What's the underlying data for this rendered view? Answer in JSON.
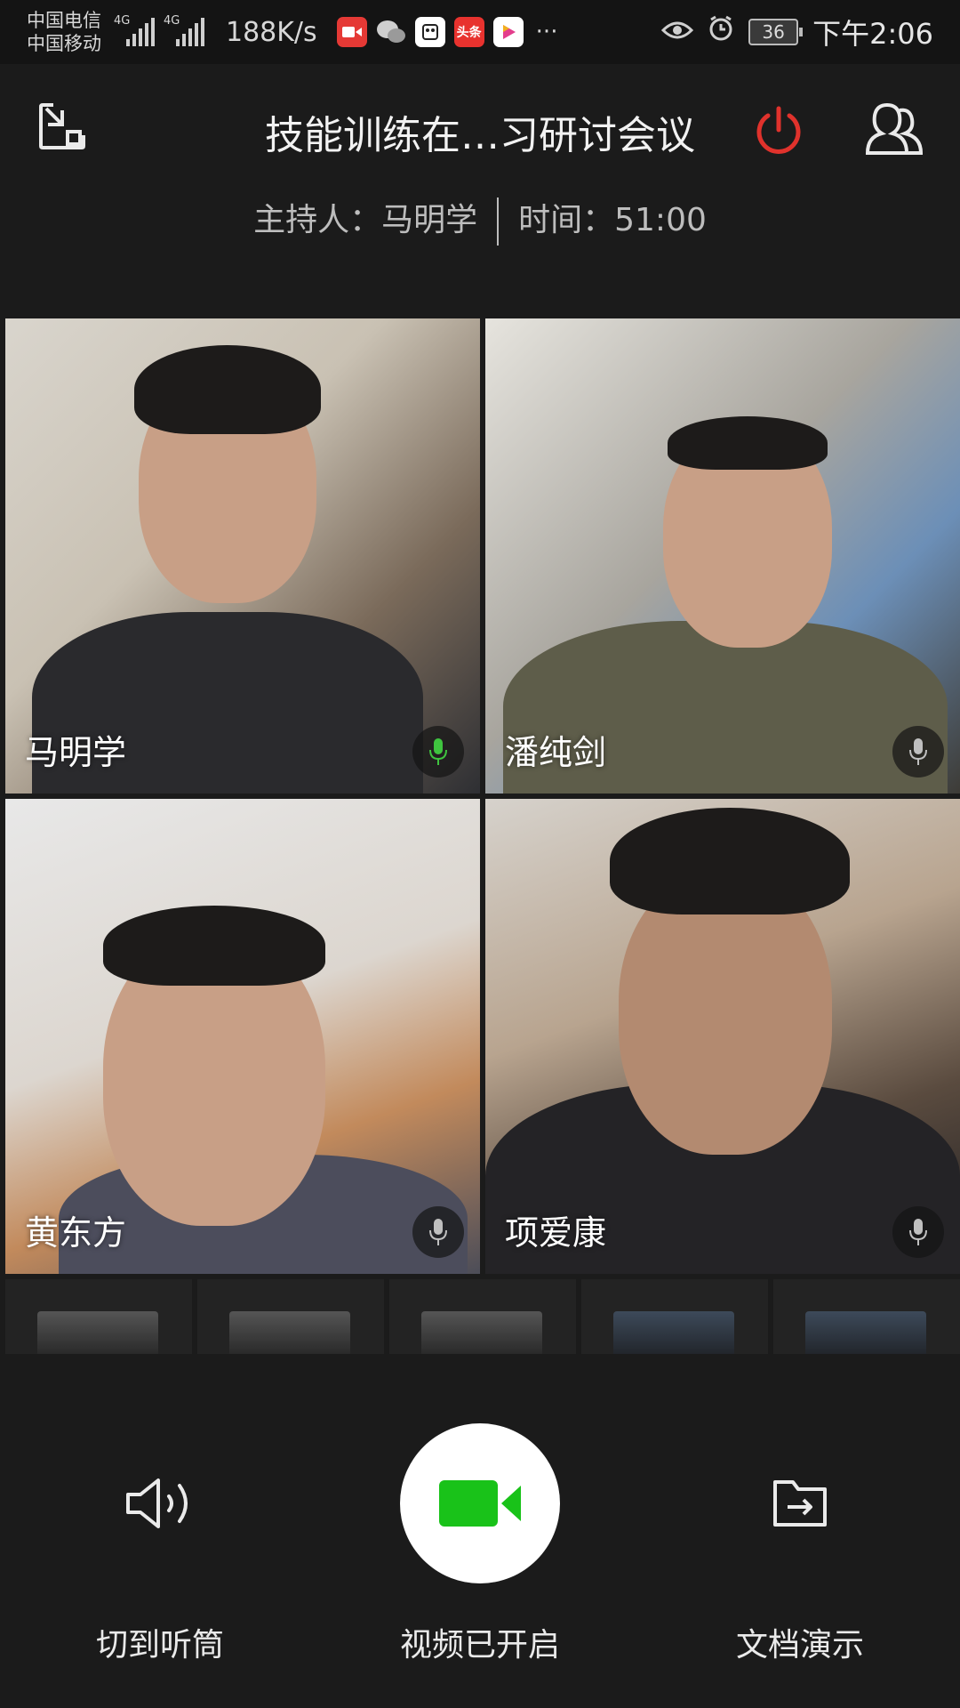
{
  "status_bar": {
    "carrier1": "中国电信",
    "carrier2": "中国移动",
    "network1": "4G",
    "network2": "4G",
    "net_speed": "188K/s",
    "more": "···",
    "battery": "36",
    "time": "下午2:06",
    "app_icons": [
      "video-app-icon",
      "wechat-icon",
      "news-app-icon",
      "toutiao-icon",
      "player-icon"
    ],
    "toutiao_label": "头条"
  },
  "header": {
    "title": "技能训练在…习研讨会议",
    "host_label": "主持人：马明学",
    "time_label": "时间：51:00"
  },
  "participants": [
    {
      "name": "马明学",
      "mic_color": "#3fc43f"
    },
    {
      "name": "潘纯剑",
      "mic_color": "#bfbfbf"
    },
    {
      "name": "黄东方",
      "mic_color": "#bfbfbf"
    },
    {
      "name": "项爱康",
      "mic_color": "#bfbfbf"
    }
  ],
  "thumbnails_count": 5,
  "controls": {
    "speaker_label": "切到听筒",
    "video_label": "视频已开启",
    "doc_label": "文档演示"
  },
  "colors": {
    "power": "#e0322c",
    "video_on": "#19c219",
    "background": "#1b1b1b"
  }
}
